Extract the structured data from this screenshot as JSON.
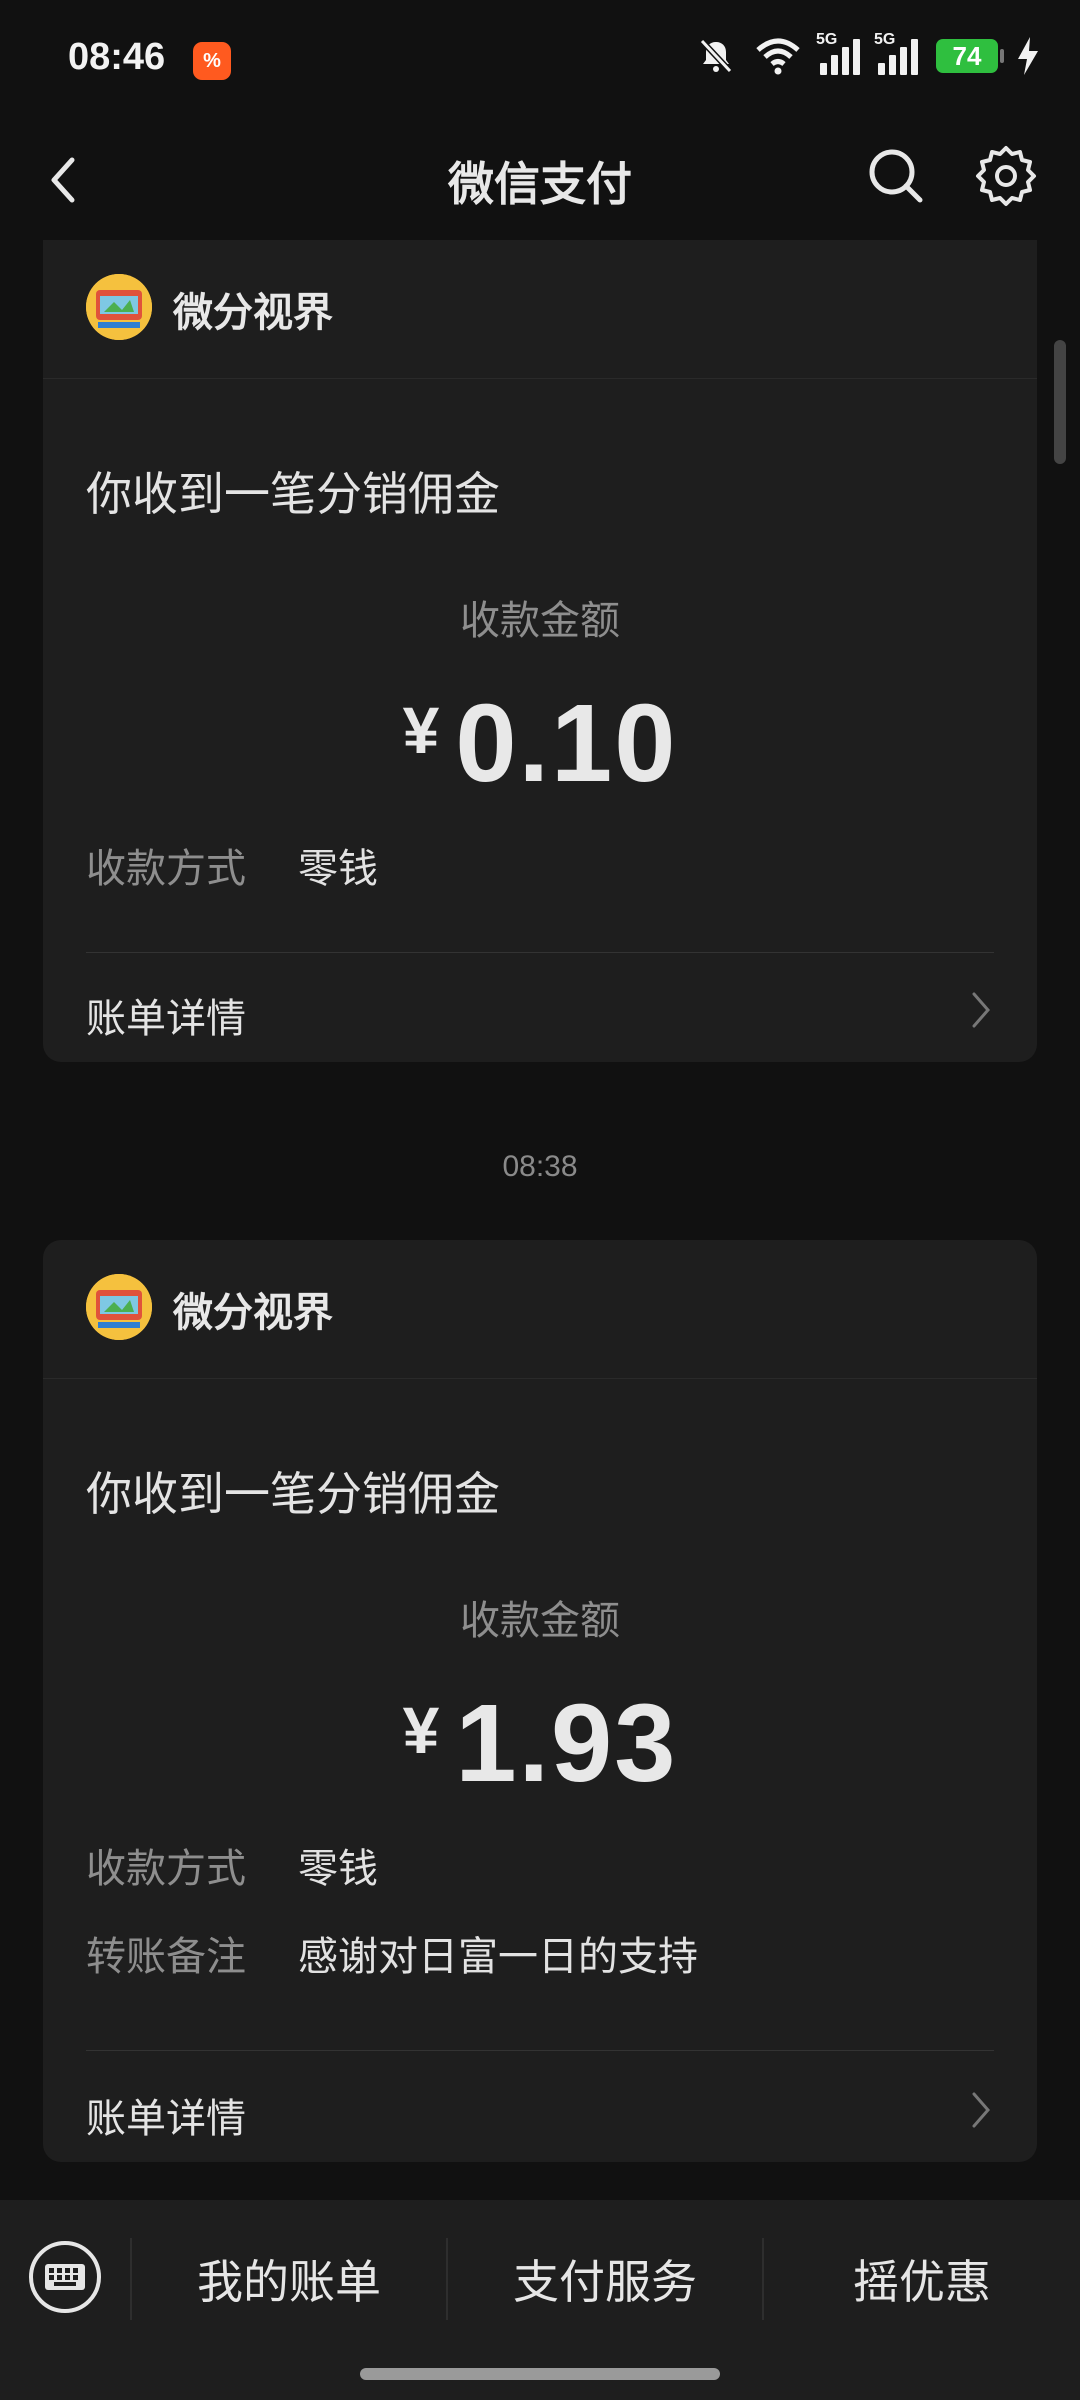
{
  "status_bar": {
    "time": "08:46",
    "app_badge": "%",
    "network1": "5G",
    "network2": "5G",
    "battery": "74"
  },
  "nav": {
    "title": "微信支付",
    "icons": [
      "back-arrow-icon",
      "search-icon",
      "gear-icon"
    ]
  },
  "messages": [
    {
      "merchant": "微分视界",
      "title": "你收到一笔分销佣金",
      "amount_label": "收款金额",
      "currency": "¥",
      "amount": "0.10",
      "fields": [
        {
          "key": "收款方式",
          "value": "零钱"
        }
      ],
      "detail_label": "账单详情"
    },
    {
      "timestamp": "08:38",
      "merchant": "微分视界",
      "title": "你收到一笔分销佣金",
      "amount_label": "收款金额",
      "currency": "¥",
      "amount": "1.93",
      "fields": [
        {
          "key": "收款方式",
          "value": "零钱"
        },
        {
          "key": "转账备注",
          "value": "感谢对日富一日的支持"
        }
      ],
      "detail_label": "账单详情"
    }
  ],
  "bottom_menu": {
    "items": [
      "我的账单",
      "支付服务",
      "摇优惠"
    ],
    "keyboard_icon": "keyboard-icon"
  },
  "colors": {
    "background": "#111111",
    "card": "#1e1e1e",
    "battery": "#2fbf3f",
    "muted_text": "#8e8e8e"
  }
}
